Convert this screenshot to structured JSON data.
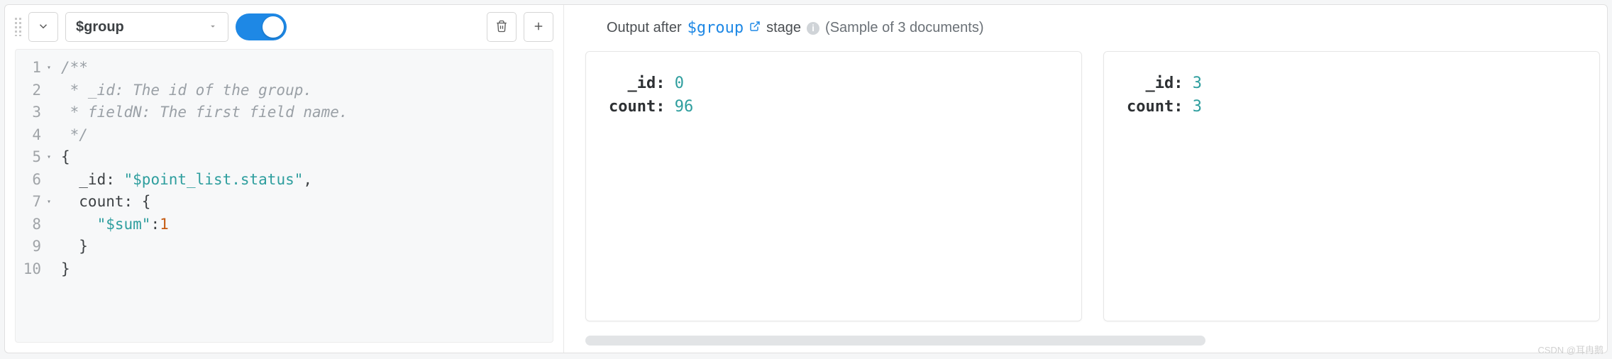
{
  "toolbar": {
    "stage_operator": "$group",
    "enabled": true
  },
  "editor": {
    "lines": [
      {
        "n": 1,
        "fold": true,
        "segments": [
          {
            "cls": "c-comment",
            "t": "/**"
          }
        ]
      },
      {
        "n": 2,
        "fold": false,
        "segments": [
          {
            "cls": "c-comment",
            "t": " * _id: The id of the group."
          }
        ]
      },
      {
        "n": 3,
        "fold": false,
        "segments": [
          {
            "cls": "c-comment",
            "t": " * fieldN: The first field name."
          }
        ]
      },
      {
        "n": 4,
        "fold": false,
        "segments": [
          {
            "cls": "c-comment",
            "t": " */"
          }
        ]
      },
      {
        "n": 5,
        "fold": true,
        "segments": [
          {
            "cls": "c-key",
            "t": "{"
          }
        ]
      },
      {
        "n": 6,
        "fold": false,
        "segments": [
          {
            "cls": "c-key",
            "t": "  _id: "
          },
          {
            "cls": "c-str",
            "t": "\"$point_list.status\""
          },
          {
            "cls": "c-key",
            "t": ","
          }
        ]
      },
      {
        "n": 7,
        "fold": true,
        "segments": [
          {
            "cls": "c-key",
            "t": "  count: {"
          }
        ]
      },
      {
        "n": 8,
        "fold": false,
        "segments": [
          {
            "cls": "c-key",
            "t": "    "
          },
          {
            "cls": "c-str",
            "t": "\"$sum\""
          },
          {
            "cls": "c-key",
            "t": ":"
          },
          {
            "cls": "c-num",
            "t": "1"
          }
        ]
      },
      {
        "n": 9,
        "fold": false,
        "segments": [
          {
            "cls": "c-key",
            "t": "  }"
          }
        ]
      },
      {
        "n": 10,
        "fold": false,
        "segments": [
          {
            "cls": "c-key",
            "t": "}"
          }
        ]
      }
    ]
  },
  "output": {
    "prefix": "Output after",
    "stage_name": "$group",
    "suffix": "stage",
    "sample_text": "(Sample of 3 documents)",
    "documents": [
      {
        "fields": [
          {
            "k": "_id",
            "v": "0"
          },
          {
            "k": "count",
            "v": "96"
          }
        ]
      },
      {
        "fields": [
          {
            "k": "_id",
            "v": "3"
          },
          {
            "k": "count",
            "v": "3"
          }
        ]
      }
    ]
  },
  "watermark": "CSDN @耳冉鹅"
}
